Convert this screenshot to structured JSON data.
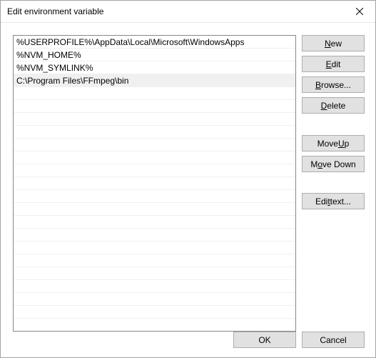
{
  "title": "Edit environment variable",
  "list": {
    "items": [
      "%USERPROFILE%\\AppData\\Local\\Microsoft\\WindowsApps",
      "%NVM_HOME%",
      "%NVM_SYMLINK%",
      "C:\\Program Files\\FFmpeg\\bin"
    ],
    "selectedIndex": 3,
    "visibleRowCount": 23
  },
  "buttons": {
    "new": "New",
    "edit": "Edit",
    "browse": "Browse...",
    "delete": "Delete",
    "moveUp": "Move Up",
    "moveDown": "Move Down",
    "editText": "Edit text...",
    "ok": "OK",
    "cancel": "Cancel"
  },
  "mnemonics": {
    "new": "N",
    "edit": "E",
    "browse": "B",
    "delete": "D",
    "moveUp": "U",
    "moveDown": "o",
    "editText": "t"
  }
}
